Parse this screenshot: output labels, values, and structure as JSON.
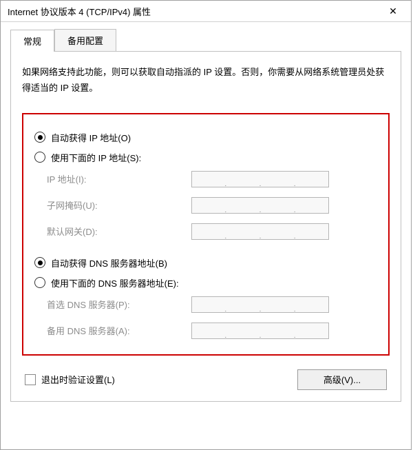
{
  "titlebar": {
    "title": "Internet 协议版本 4 (TCP/IPv4) 属性",
    "close": "✕"
  },
  "tabs": {
    "general": "常规",
    "alternate": "备用配置"
  },
  "intro": "如果网络支持此功能，则可以获取自动指派的 IP 设置。否则，你需要从网络系统管理员处获得适当的 IP 设置。",
  "ip_section": {
    "auto_label": "自动获得 IP 地址(O)",
    "manual_label": "使用下面的 IP 地址(S):",
    "selected": "auto",
    "fields": {
      "ip": "IP 地址(I):",
      "subnet": "子网掩码(U):",
      "gateway": "默认网关(D):"
    }
  },
  "dns_section": {
    "auto_label": "自动获得 DNS 服务器地址(B)",
    "manual_label": "使用下面的 DNS 服务器地址(E):",
    "selected": "auto",
    "fields": {
      "preferred": "首选 DNS 服务器(P):",
      "alternate": "备用 DNS 服务器(A):"
    }
  },
  "validate_label": "退出时验证设置(L)",
  "advanced_btn": "高级(V)..."
}
